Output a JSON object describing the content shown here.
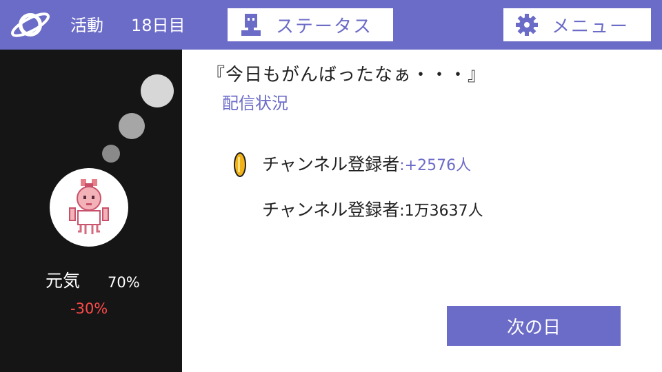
{
  "topbar": {
    "activity_label": "活動",
    "day_label": "18日目",
    "status_button": {
      "label": "ステータス",
      "icon": "person-icon"
    },
    "menu_button": {
      "label": "メニュー",
      "icon": "gear-icon"
    },
    "logo_icon": "planet-icon",
    "bar_color": "#6b6bc8"
  },
  "side": {
    "genki_label": "元気",
    "genki_value": "70%",
    "genki_delta": "-30%",
    "delta_color": "#ff4a4a"
  },
  "main": {
    "quote": "『今日もがんばったなぁ・・・』",
    "subheading": "配信状況",
    "rows": [
      {
        "label": "チャンネル登録者",
        "value": ":+2576人",
        "icon": "coin-icon"
      },
      {
        "label": "チャンネル登録者",
        "value": ":1万3637人"
      }
    ],
    "next_button": "次の日"
  }
}
